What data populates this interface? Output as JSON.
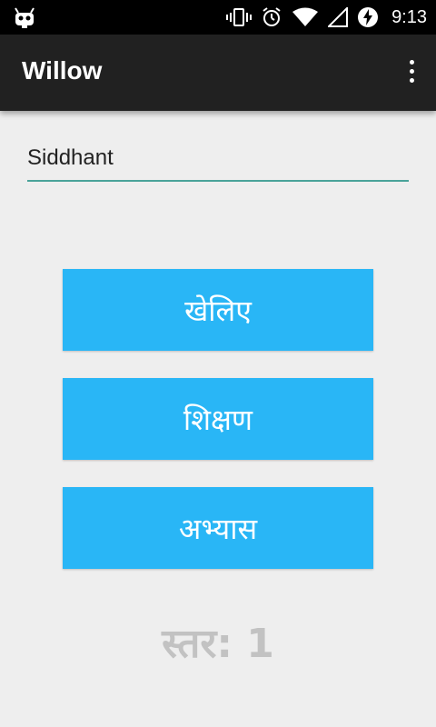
{
  "status_bar": {
    "time": "9:13",
    "icons": [
      "android-debug-icon",
      "vibrate-icon",
      "alarm-icon",
      "wifi-icon",
      "signal-icon",
      "battery-charging-icon"
    ]
  },
  "app_bar": {
    "title": "Willow",
    "overflow_icon": "more-vert-icon"
  },
  "name_input": {
    "value": "Siddhant",
    "underline_color": "#4aa39a"
  },
  "buttons": {
    "play": "खेलिए",
    "learn": "शिक्षण",
    "practice": "अभ्यास",
    "color": "#29b6f6"
  },
  "level": {
    "text": "स्तर: 1"
  }
}
